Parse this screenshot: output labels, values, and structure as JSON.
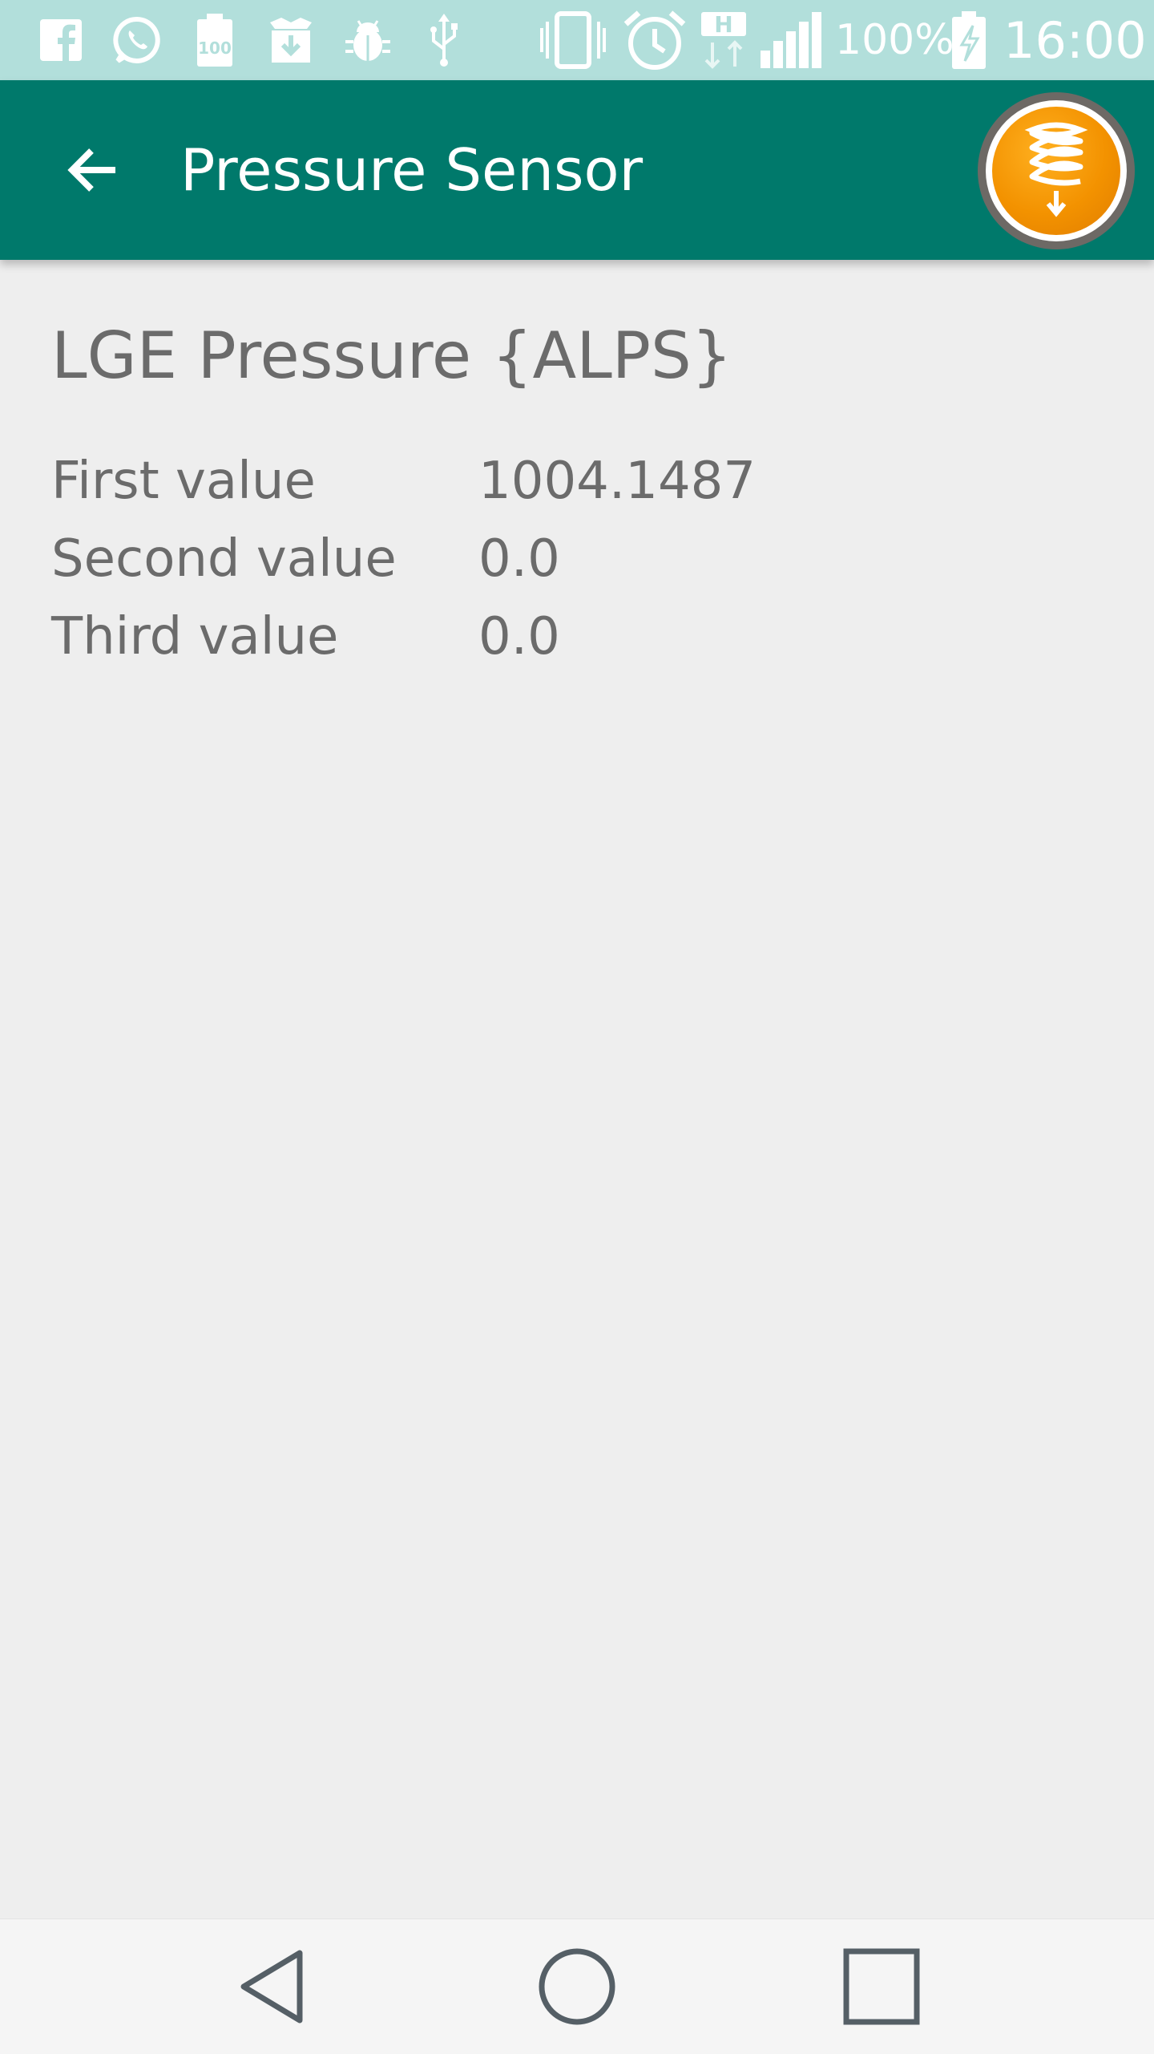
{
  "status_bar": {
    "icons": [
      "facebook-icon",
      "whatsapp-icon",
      "battery-100-notification-icon",
      "download-box-icon",
      "android-debug-icon",
      "usb-icon",
      "vibrate-icon",
      "alarm-icon",
      "hspa-data-icon",
      "signal-icon",
      "battery-charging-icon"
    ],
    "battery_percent": "100%",
    "time": "16:00"
  },
  "app_bar": {
    "title": "Pressure Sensor",
    "back_icon": "arrow-back-icon",
    "badge_icon": "spring-download-icon",
    "color": "#00796b"
  },
  "sensor": {
    "name": "LGE Pressure {ALPS}",
    "rows": [
      {
        "label": "First value",
        "value": "1004.1487"
      },
      {
        "label": "Second value",
        "value": "0.0"
      },
      {
        "label": "Third value",
        "value": "0.0"
      }
    ]
  },
  "nav_bar": {
    "icons": [
      "back-triangle-icon",
      "home-circle-icon",
      "recents-square-icon"
    ]
  },
  "colors": {
    "status_bar": "#b2dfdb",
    "app_bar": "#00796b",
    "background": "#eeeeee",
    "text": "#6b6b6b",
    "badge_orange": "#f39200"
  }
}
